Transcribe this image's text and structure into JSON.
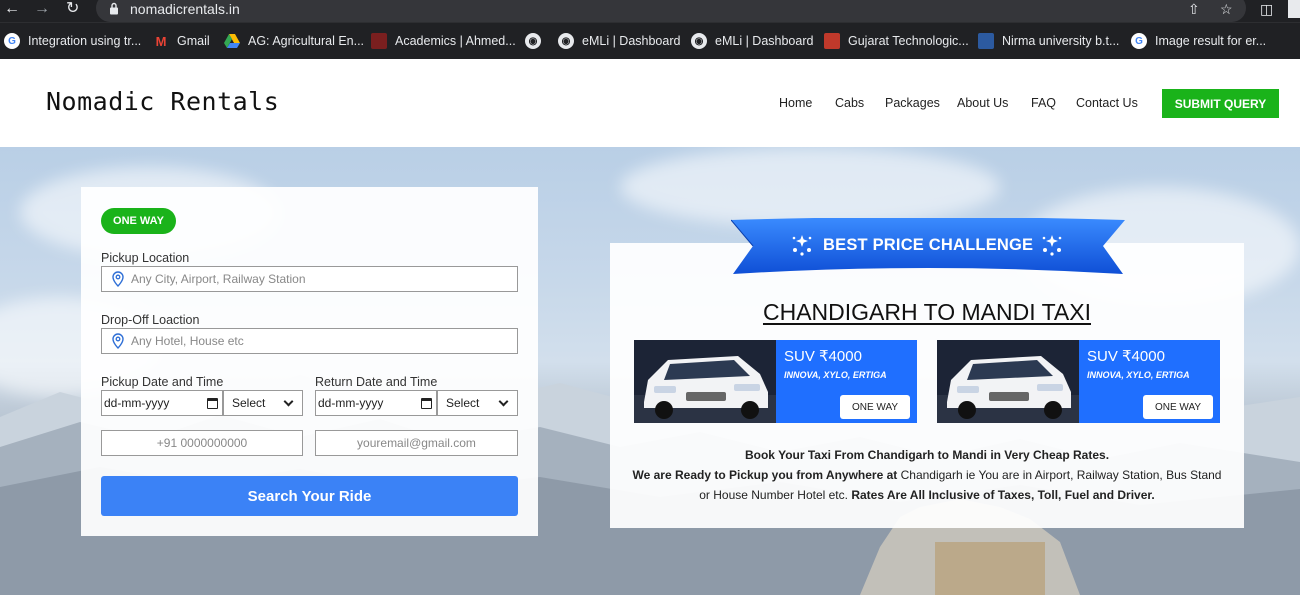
{
  "browser": {
    "url": "nomadicrentals.in",
    "bookmarks": [
      {
        "label": "Integration using tr...",
        "icon": "google-icon",
        "color": "#ffffff"
      },
      {
        "label": "Gmail",
        "icon": "gmail-icon",
        "color": "#ea4335"
      },
      {
        "label": "AG: Agricultural En...",
        "icon": "drive-icon",
        "color": "#34a853"
      },
      {
        "label": "Academics | Ahmed...",
        "icon": "bookmark-icon",
        "color": "#7a1f1f"
      },
      {
        "label": "",
        "icon": "globe-icon",
        "color": "#dddddd"
      },
      {
        "label": "eMLi | Dashboard",
        "icon": "globe-icon",
        "color": "#dddddd"
      },
      {
        "label": "eMLi | Dashboard",
        "icon": "globe-icon",
        "color": "#dddddd"
      },
      {
        "label": "Gujarat Technologic...",
        "icon": "gtu-icon",
        "color": "#c0392b"
      },
      {
        "label": "Nirma university b.t...",
        "icon": "nirma-icon",
        "color": "#2c5aa0"
      },
      {
        "label": "Image result for er...",
        "icon": "google-icon",
        "color": "#ffffff"
      }
    ]
  },
  "header": {
    "logo": "Nomadic Rentals",
    "nav": [
      "Home",
      "Cabs",
      "Packages",
      "About Us",
      "FAQ",
      "Contact Us"
    ],
    "cta": "SUBMIT QUERY"
  },
  "form": {
    "trip_type": "ONE WAY",
    "pickup_label": "Pickup Location",
    "pickup_placeholder": "Any City, Airport, Railway Station",
    "dropoff_label": "Drop-Off Loaction",
    "dropoff_placeholder": "Any Hotel, House etc",
    "pickup_dt_label": "Pickup Date and Time",
    "return_dt_label": "Return Date and Time",
    "date_placeholder": "dd-mm-yyyy",
    "time_select": "Select",
    "phone_placeholder": "+91 0000000000",
    "email_placeholder": "youremail@gmail.com",
    "search_button": "Search Your Ride"
  },
  "promo": {
    "badge": "BEST PRICE CHALLENGE",
    "title": "CHANDIGARH TO MANDI TAXI",
    "cars": [
      {
        "price": "SUV ₹4000",
        "models": "INNOVA, XYLO, ERTIGA",
        "button": "ONE WAY"
      },
      {
        "price": "SUV ₹4000",
        "models": "INNOVA, XYLO, ERTIGA",
        "button": "ONE WAY"
      }
    ],
    "line1": "Book Your Taxi From Chandigarh to Mandi in Very Cheap Rates.",
    "line2_bold": "We are Ready to Pickup you from Anywhere at",
    "line2_rest": "Chandigarh ie You are in Airport, Railway Station, Bus Stand",
    "line3_rest": "or House Number Hotel etc.",
    "line3_bold": "Rates Are All Inclusive of Taxes, Toll, Fuel and Driver."
  },
  "colors": {
    "accent_green": "#1ab31a",
    "accent_blue": "#3b82f6",
    "card_blue": "#1f6fff"
  }
}
